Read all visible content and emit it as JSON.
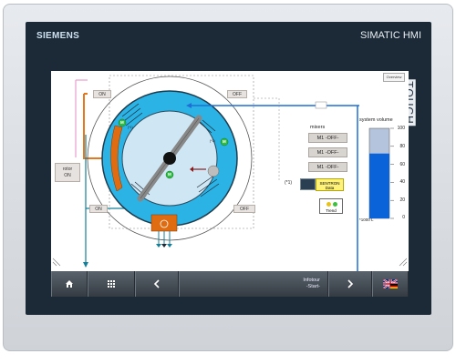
{
  "device": {
    "brand": "SIEMENS",
    "product": "SIMATIC HMI",
    "side_label": "TOUCH"
  },
  "screen": {
    "overview_label": "Overview",
    "buttons": {
      "on_top": "ON",
      "off_top": "OFF",
      "on_bottom": "ON",
      "off_bottom": "OFF",
      "rotor_line1": "rotor",
      "rotor_line2": "ON"
    },
    "mixers": {
      "title": "mixers",
      "items": [
        "M1 -OFF-",
        "M1 -OFF-",
        "M1 -OFF-"
      ]
    },
    "sentron": {
      "marker": "(*1)",
      "line1": "SENTRON",
      "line2": "Data"
    },
    "trend": {
      "label": "Trend"
    },
    "motor_labels": [
      "M",
      "M",
      "M"
    ],
    "motor_tags": [
      "(*1)",
      "(*1)"
    ],
    "volume": {
      "title": "system volume",
      "ticks": [
        "100",
        "80",
        "60",
        "40",
        "20",
        "0"
      ],
      "unit": "*1000 L",
      "level_percent": 72
    }
  },
  "taskbar": {
    "info_line1": "Infotour",
    "info_line2": "-Start-"
  },
  "colors": {
    "accent_blue": "#1d6fd6",
    "vessel_cyan": "#2bb3e6",
    "level_blue": "#0b63d9",
    "pipe_orange": "#e5771e"
  },
  "icons": [
    "home-icon",
    "apps-grid-icon",
    "chevron-left-icon",
    "chevron-right-icon",
    "language-flag-icon"
  ]
}
